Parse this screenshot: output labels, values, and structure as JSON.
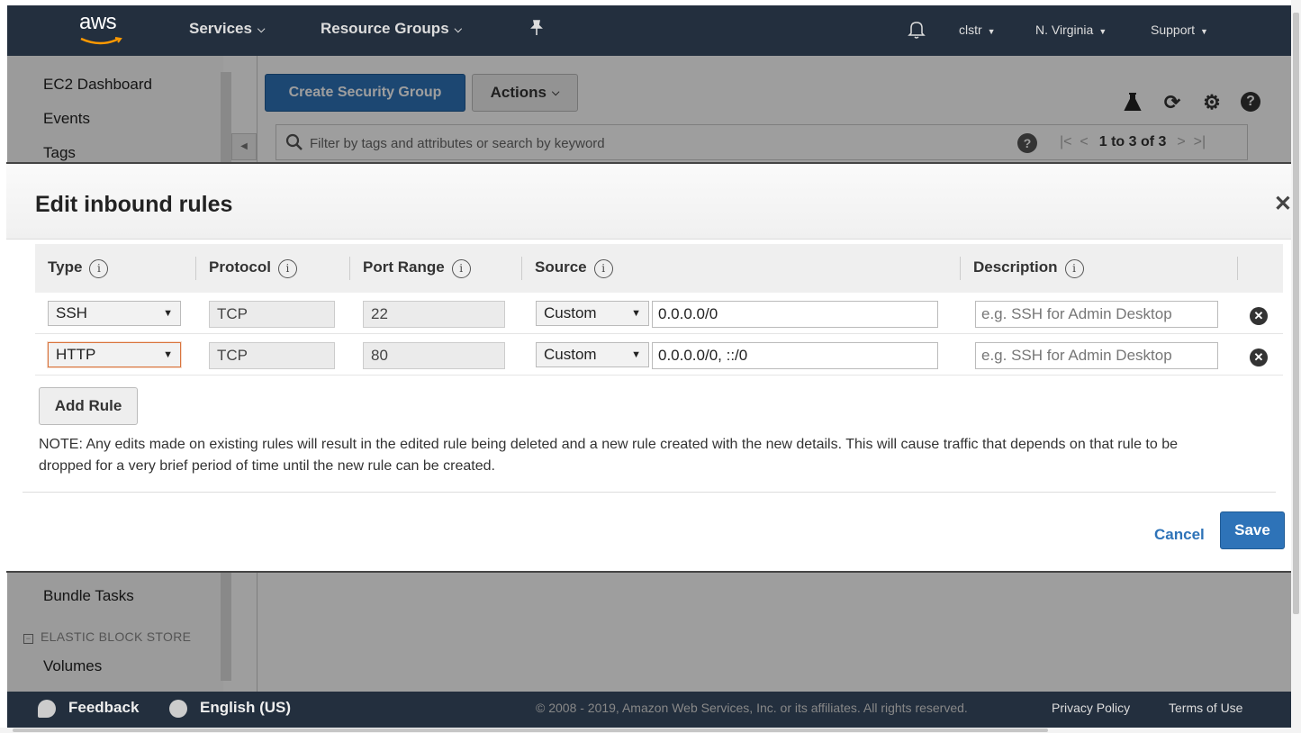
{
  "topnav": {
    "logo": "aws",
    "services": "Services",
    "resource_groups": "Resource Groups",
    "account": "clstr",
    "region": "N. Virginia",
    "support": "Support"
  },
  "sidebar": {
    "items_top": [
      "EC2 Dashboard",
      "Events",
      "Tags"
    ],
    "bundle_tasks": "Bundle Tasks",
    "section_ebs": "ELASTIC BLOCK STORE",
    "volumes": "Volumes"
  },
  "toolbar": {
    "create_security_group": "Create Security Group",
    "actions": "Actions"
  },
  "search": {
    "placeholder": "Filter by tags and attributes or search by keyword",
    "pagination": "1 to 3 of 3"
  },
  "modal": {
    "title": "Edit inbound rules",
    "columns": {
      "type": "Type",
      "protocol": "Protocol",
      "port_range": "Port Range",
      "source": "Source",
      "description": "Description"
    },
    "rows": [
      {
        "type": "SSH",
        "protocol": "TCP",
        "port": "22",
        "source_type": "Custom",
        "source": "0.0.0.0/0",
        "description_placeholder": "e.g. SSH for Admin Desktop"
      },
      {
        "type": "HTTP",
        "protocol": "TCP",
        "port": "80",
        "source_type": "Custom",
        "source": "0.0.0.0/0, ::/0",
        "description_placeholder": "e.g. SSH for Admin Desktop"
      }
    ],
    "add_rule": "Add Rule",
    "note": "NOTE: Any edits made on existing rules will result in the edited rule being deleted and a new rule created with the new details. This will cause traffic that depends on that rule to be dropped for a very brief period of time until the new rule can be created.",
    "cancel": "Cancel",
    "save": "Save"
  },
  "footer": {
    "feedback": "Feedback",
    "language": "English (US)",
    "copyright": "© 2008 - 2019, Amazon Web Services, Inc. or its affiliates. All rights reserved.",
    "privacy": "Privacy Policy",
    "terms": "Terms of Use"
  },
  "colors": {
    "nav_bg": "#232f3e",
    "primary_button": "#2e73b8",
    "overlay": "rgba(0,0,0,0.38)"
  }
}
